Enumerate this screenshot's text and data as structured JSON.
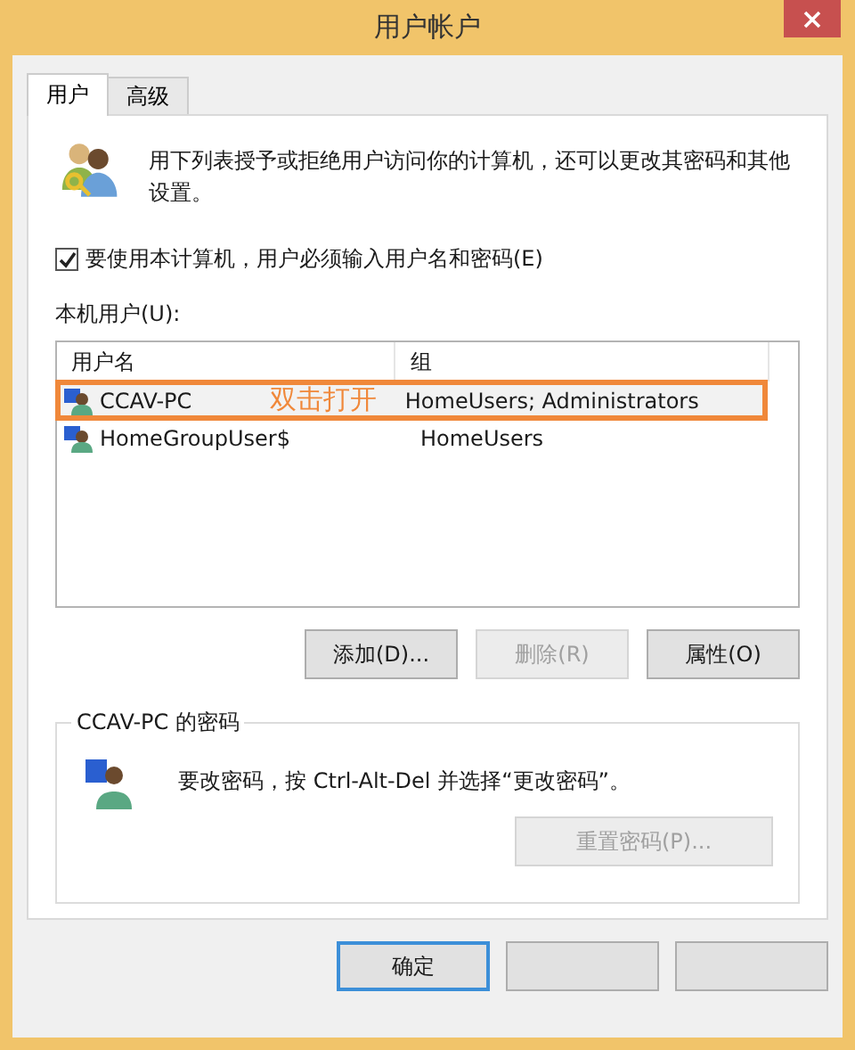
{
  "window": {
    "title": "用户帐户"
  },
  "tabs": [
    {
      "label": "用户",
      "selected": true
    },
    {
      "label": "高级",
      "selected": false
    }
  ],
  "intro": "用下列表授予或拒绝用户访问你的计算机，还可以更改其密码和其他设置。",
  "require_login": {
    "label": "要使用本计算机，用户必须输入用户名和密码(E)",
    "checked": true
  },
  "users_label": "本机用户(U):",
  "table": {
    "columns": [
      "用户名",
      "组"
    ],
    "rows": [
      {
        "name": "CCAV-PC",
        "group": "HomeUsers; Administrators",
        "selected": true,
        "annotation": "双击打开"
      },
      {
        "name": "HomeGroupUser$",
        "group": "HomeUsers",
        "selected": false
      }
    ]
  },
  "user_buttons": [
    {
      "label": "添加(D)...",
      "disabled": false
    },
    {
      "label": "删除(R)",
      "disabled": true
    },
    {
      "label": "属性(O)",
      "disabled": false
    }
  ],
  "password_group": {
    "title": "CCAV-PC 的密码",
    "text": "要改密码，按 Ctrl-Alt-Del 并选择“更改密码”。",
    "button": {
      "label": "重置密码(P)...",
      "disabled": true
    }
  },
  "dialog_buttons": [
    {
      "label": "确定",
      "default": true
    },
    {
      "default": false
    },
    {
      "default": false
    }
  ]
}
